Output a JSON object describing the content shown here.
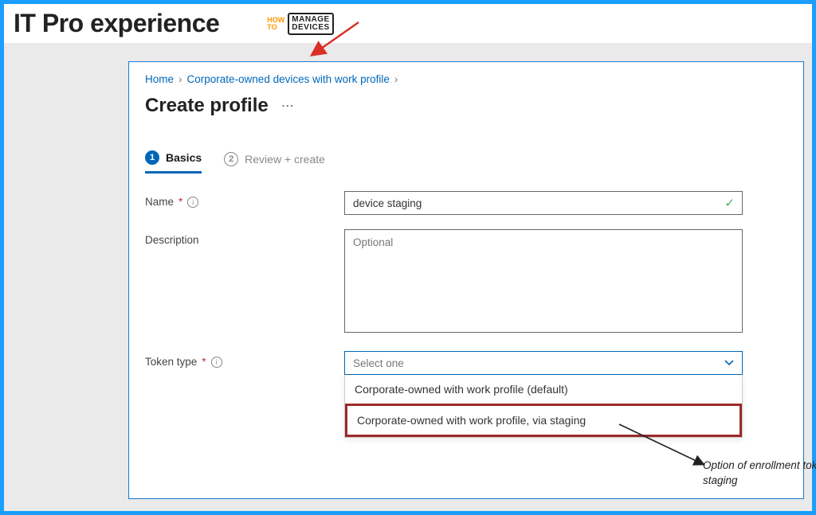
{
  "heading": "IT Pro experience",
  "logo": {
    "left_line1": "HOW",
    "left_line2": "TO",
    "right_line1": "MANAGE",
    "right_line2": "DEVICES"
  },
  "breadcrumb": {
    "home": "Home",
    "parent": "Corporate-owned devices with work profile"
  },
  "page_title": "Create profile",
  "tabs": {
    "basics": {
      "num": "1",
      "label": "Basics"
    },
    "review": {
      "num": "2",
      "label": "Review + create"
    }
  },
  "form": {
    "name_label": "Name",
    "name_value": "device staging",
    "description_label": "Description",
    "description_placeholder": "Optional",
    "token_label": "Token type",
    "token_placeholder": "Select one",
    "token_options": [
      "Corporate-owned with work profile (default)",
      "Corporate-owned with work profile, via staging"
    ]
  },
  "annotation": "Option of enrollment token for device staging"
}
